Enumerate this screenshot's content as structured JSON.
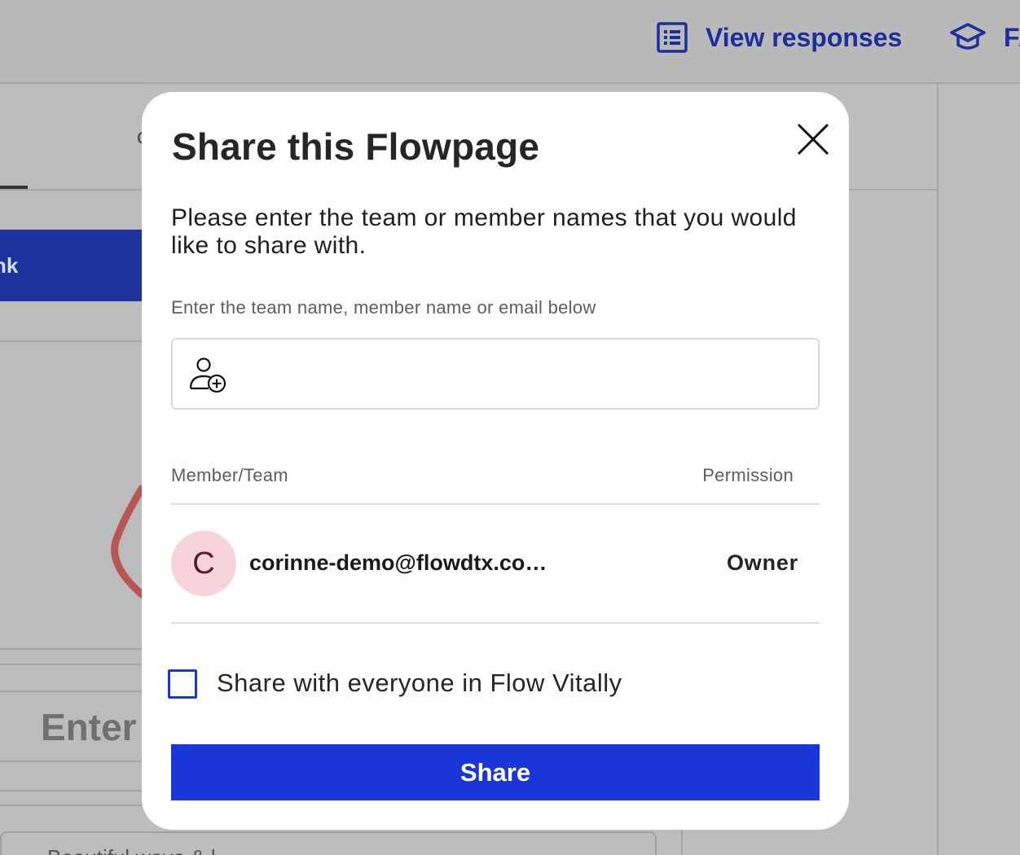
{
  "header": {
    "view_responses_label": "View responses",
    "faq_label_partial": "FA"
  },
  "background": {
    "left_button_partial": "nk",
    "enter_partial": "Enter",
    "partial_c": "c",
    "bottom_partial": "Beautiful wave & l"
  },
  "modal": {
    "title": "Share this Flowpage",
    "description": "Please enter the team or member names that you would like to share with.",
    "field_label": "Enter the team name, member name or email below",
    "search_value": "",
    "columns": {
      "member": "Member/Team",
      "permission": "Permission"
    },
    "members": [
      {
        "initial": "C",
        "email": "corinne-demo@flowdtx.co…",
        "permission": "Owner",
        "avatar_color": "#f7d4db"
      }
    ],
    "share_everyone_label": "Share with everyone in Flow Vitally",
    "share_everyone_checked": false,
    "share_button_label": "Share"
  },
  "colors": {
    "accent": "#1b36d6",
    "header_link": "#1d2f9a",
    "overlay": "#bdbdbd"
  },
  "icons": {
    "view_responses": "list-icon",
    "faq": "graduation-cap-icon",
    "close": "close-icon",
    "add_user": "add-user-icon"
  }
}
